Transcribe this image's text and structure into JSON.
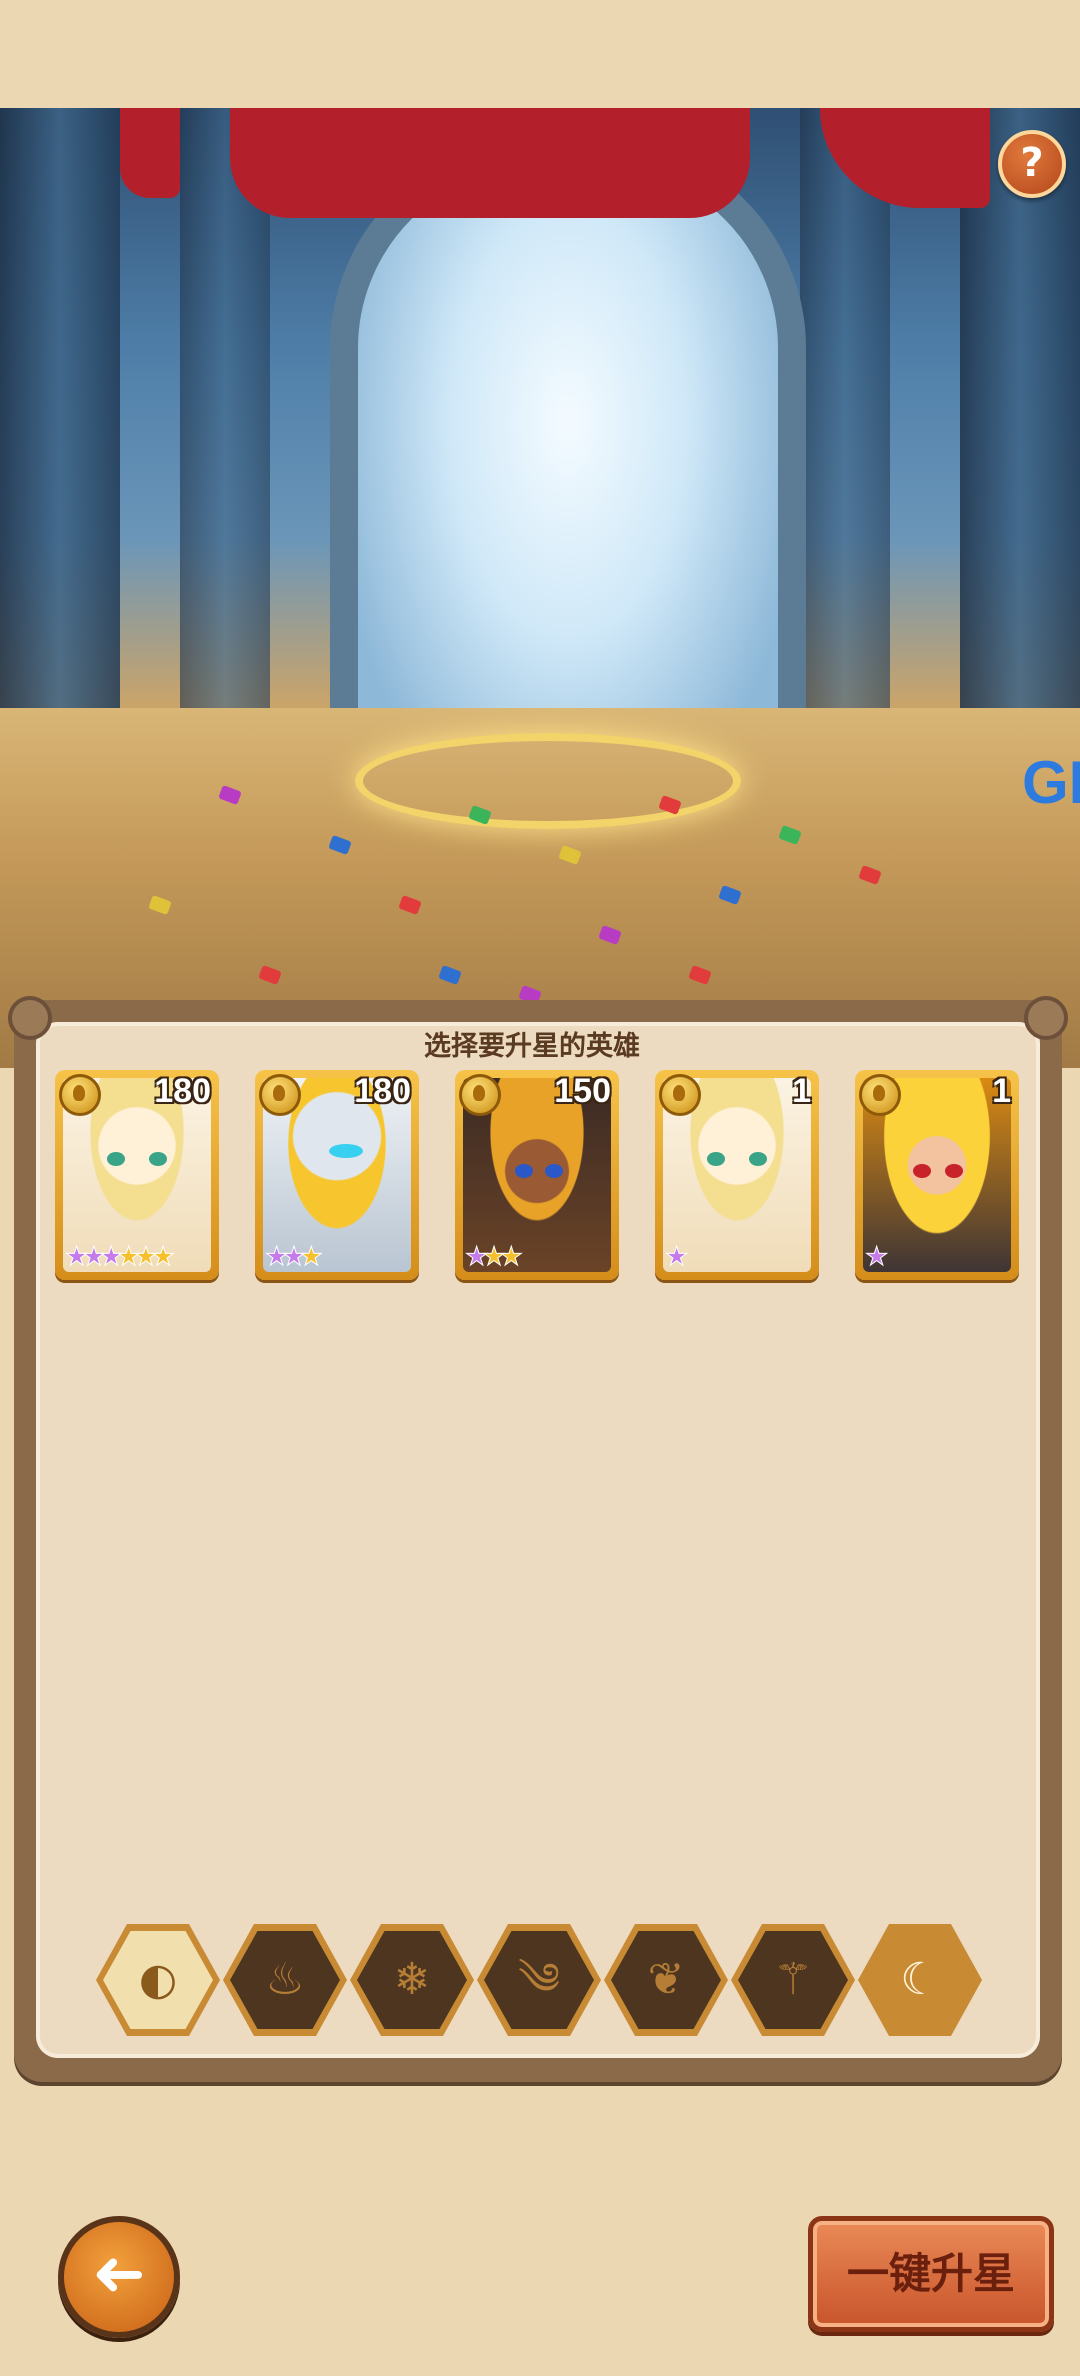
{
  "help_icon": "?",
  "scene_text": "GI",
  "panel": {
    "title": "选择要升星的英雄"
  },
  "heroes": [
    {
      "level": "180",
      "purple_stars": "★★★",
      "gold_stars": "★★★",
      "portrait": "blonde-girl"
    },
    {
      "level": "180",
      "purple_stars": "★★",
      "gold_stars": "★",
      "portrait": "robot"
    },
    {
      "level": "150",
      "purple_stars": "★",
      "gold_stars": "★★",
      "portrait": "pharaoh"
    },
    {
      "level": "1",
      "purple_stars": "★",
      "gold_stars": "",
      "portrait": "blonde-girl"
    },
    {
      "level": "1",
      "purple_stars": "★",
      "gold_stars": "",
      "portrait": "armored-warrior"
    }
  ],
  "filters": [
    {
      "name": "all",
      "glyph": "◐"
    },
    {
      "name": "fire",
      "glyph": "♨"
    },
    {
      "name": "ice",
      "glyph": "❄"
    },
    {
      "name": "wind",
      "glyph": "༄"
    },
    {
      "name": "nature",
      "glyph": "❦"
    },
    {
      "name": "dark",
      "glyph": "⚚"
    },
    {
      "name": "light",
      "glyph": "☾"
    }
  ],
  "buttons": {
    "back": "➜",
    "upgrade": "一键升星"
  },
  "colors": {
    "background": "#ecd7b3",
    "panel_border": "#8a6a49",
    "card_gold": "#f6c348",
    "button_orange": "#ea8a57"
  }
}
